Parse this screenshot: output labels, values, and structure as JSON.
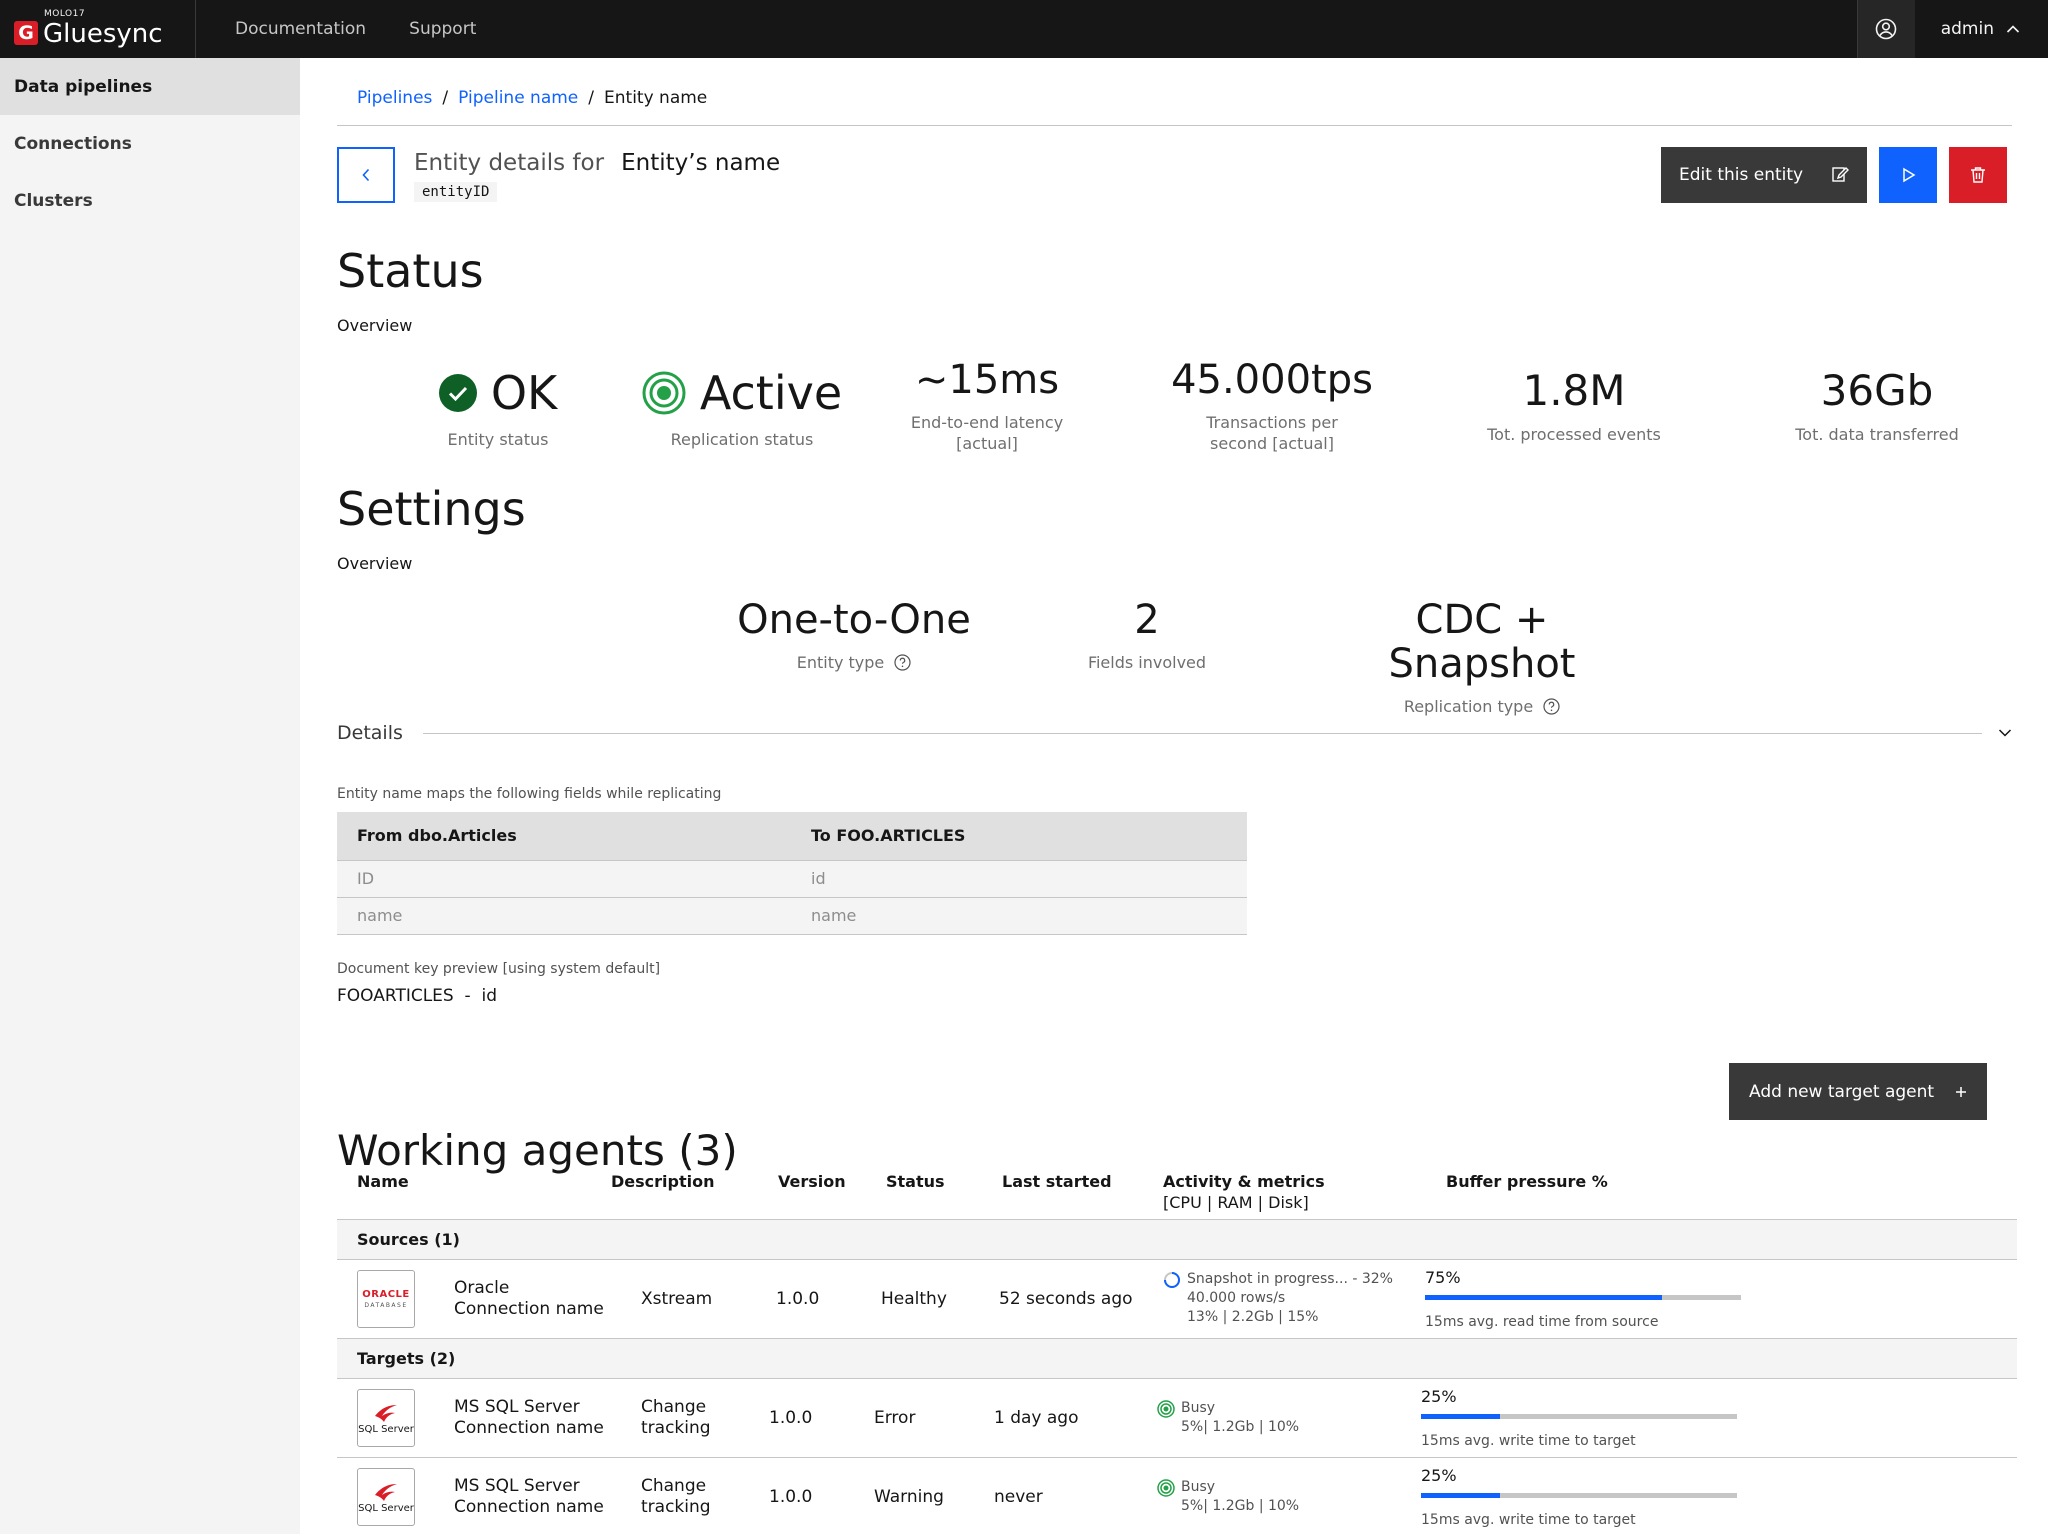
{
  "brand": {
    "tag": "MOLO17",
    "name": "Gluesync",
    "mark": "G"
  },
  "topnav": [
    "Documentation",
    "Support"
  ],
  "user": {
    "name": "admin"
  },
  "sidebar": [
    "Data pipelines",
    "Connections",
    "Clusters"
  ],
  "breadcrumb": {
    "pipelines": "Pipelines",
    "pipeline": "Pipeline name",
    "entity": "Entity name",
    "sep": "/"
  },
  "entity": {
    "label": "Entity details for",
    "name": "Entity’s name",
    "id": "entityID"
  },
  "actions": {
    "edit": "Edit this entity"
  },
  "status": {
    "title": "Status",
    "overview": "Overview",
    "metrics": [
      {
        "value": "OK",
        "caption": "Entity status"
      },
      {
        "value": "Active",
        "caption": "Replication status"
      },
      {
        "value": "~15ms",
        "caption1": "End-to-end latency",
        "caption2": "[actual]"
      },
      {
        "value": "45.000tps",
        "caption1": "Transactions per",
        "caption2": "second [actual]"
      },
      {
        "value": "1.8M",
        "caption": "Tot. processed events"
      },
      {
        "value": "36Gb",
        "caption": "Tot. data transferred"
      }
    ]
  },
  "settings": {
    "title": "Settings",
    "overview": "Overview",
    "metrics": [
      {
        "value": "One-to-One",
        "caption": "Entity type"
      },
      {
        "value": "2",
        "caption": "Fields involved"
      },
      {
        "value": "CDC + Snapshot",
        "caption": "Replication type"
      }
    ]
  },
  "details": {
    "title": "Details",
    "caption": "Entity name maps the following fields while replicating",
    "columns": [
      "From dbo.Articles",
      "To FOO.ARTICLES"
    ],
    "rows": [
      [
        "ID",
        "id"
      ],
      [
        "name",
        "name"
      ]
    ],
    "doc_key_caption": "Document key preview [using system default]",
    "doc_key_value": "FOOARTICLES  -  id"
  },
  "agents": {
    "title": "Working agents (3)",
    "add_label": "Add new target agent",
    "columns": {
      "name": "Name",
      "description": "Description",
      "version": "Version",
      "status": "Status",
      "last_started": "Last started",
      "activity": "Activity & metrics",
      "activity_sub": "[CPU | RAM | Disk]",
      "buffer": "Buffer pressure %"
    },
    "sources_label": "Sources (1)",
    "targets_label": "Targets (2)",
    "sources": [
      {
        "logo": "ORACLE",
        "logo_sub": "DATABASE",
        "name1": "Oracle",
        "name2": "Connection name",
        "description1": "Xstream",
        "description2": "",
        "version": "1.0.0",
        "status": "Healthy",
        "last_started": "52 seconds ago",
        "activity1": "Snapshot in progress... - 32%",
        "activity2": "40.000 rows/s",
        "activity3": "13% | 2.2Gb | 15%",
        "buffer_pct": "75%",
        "buffer_value": 0.75,
        "buffer_note": "15ms avg. read time from source"
      }
    ],
    "targets": [
      {
        "logo": "SQL Server",
        "name1": "MS SQL Server",
        "name2": "Connection name",
        "description1": "Change",
        "description2": "tracking",
        "version": "1.0.0",
        "status": "Error",
        "last_started": "1 day ago",
        "activity1": "Busy",
        "activity2": "5%| 1.2Gb | 10%",
        "buffer_pct": "25%",
        "buffer_value": 0.25,
        "buffer_note": "15ms avg. write time to target"
      },
      {
        "logo": "SQL Server",
        "name1": "MS SQL Server",
        "name2": "Connection name",
        "description1": "Change",
        "description2": "tracking",
        "version": "1.0.0",
        "status": "Warning",
        "last_started": "never",
        "activity1": "Busy",
        "activity2": "5%| 1.2Gb | 10%",
        "buffer_pct": "25%",
        "buffer_value": 0.25,
        "buffer_note": "15ms avg. write time to target"
      }
    ]
  },
  "colors": {
    "accent": "#0f62fe",
    "danger": "#da1e28",
    "success": "#24a148",
    "ok": "#0e6027",
    "dark": "#161616"
  }
}
